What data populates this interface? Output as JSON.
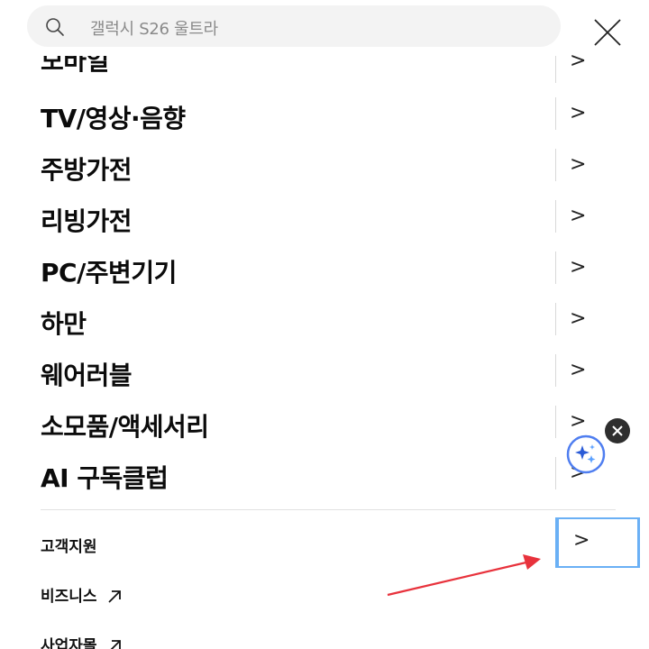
{
  "search": {
    "placeholder": "갤럭시 S26 울트라"
  },
  "categories": [
    {
      "label": "모바일",
      "chevron": ">"
    },
    {
      "label": "TV/영상·음향",
      "chevron": ">"
    },
    {
      "label": "주방가전",
      "chevron": ">"
    },
    {
      "label": "리빙가전",
      "chevron": ">"
    },
    {
      "label": "PC/주변기기",
      "chevron": ">"
    },
    {
      "label": "하만",
      "chevron": ">"
    },
    {
      "label": "웨어러블",
      "chevron": ">"
    },
    {
      "label": "소모품/액세서리",
      "chevron": ">"
    },
    {
      "label": "AI 구독클럽",
      "chevron": ">"
    }
  ],
  "support": {
    "label": "고객지원",
    "chevron": ">"
  },
  "links": [
    {
      "label": "비즈니스"
    },
    {
      "label": "사업자몰"
    }
  ],
  "colors": {
    "highlight": "#6ab0f5",
    "arrow": "#e8323c",
    "ai_badge": "#2a5bd7"
  },
  "icons": {
    "search": "search-icon",
    "close": "close-icon",
    "chevron": "chevron-right-icon",
    "external": "external-link-icon",
    "ai": "sparkle-icon"
  }
}
